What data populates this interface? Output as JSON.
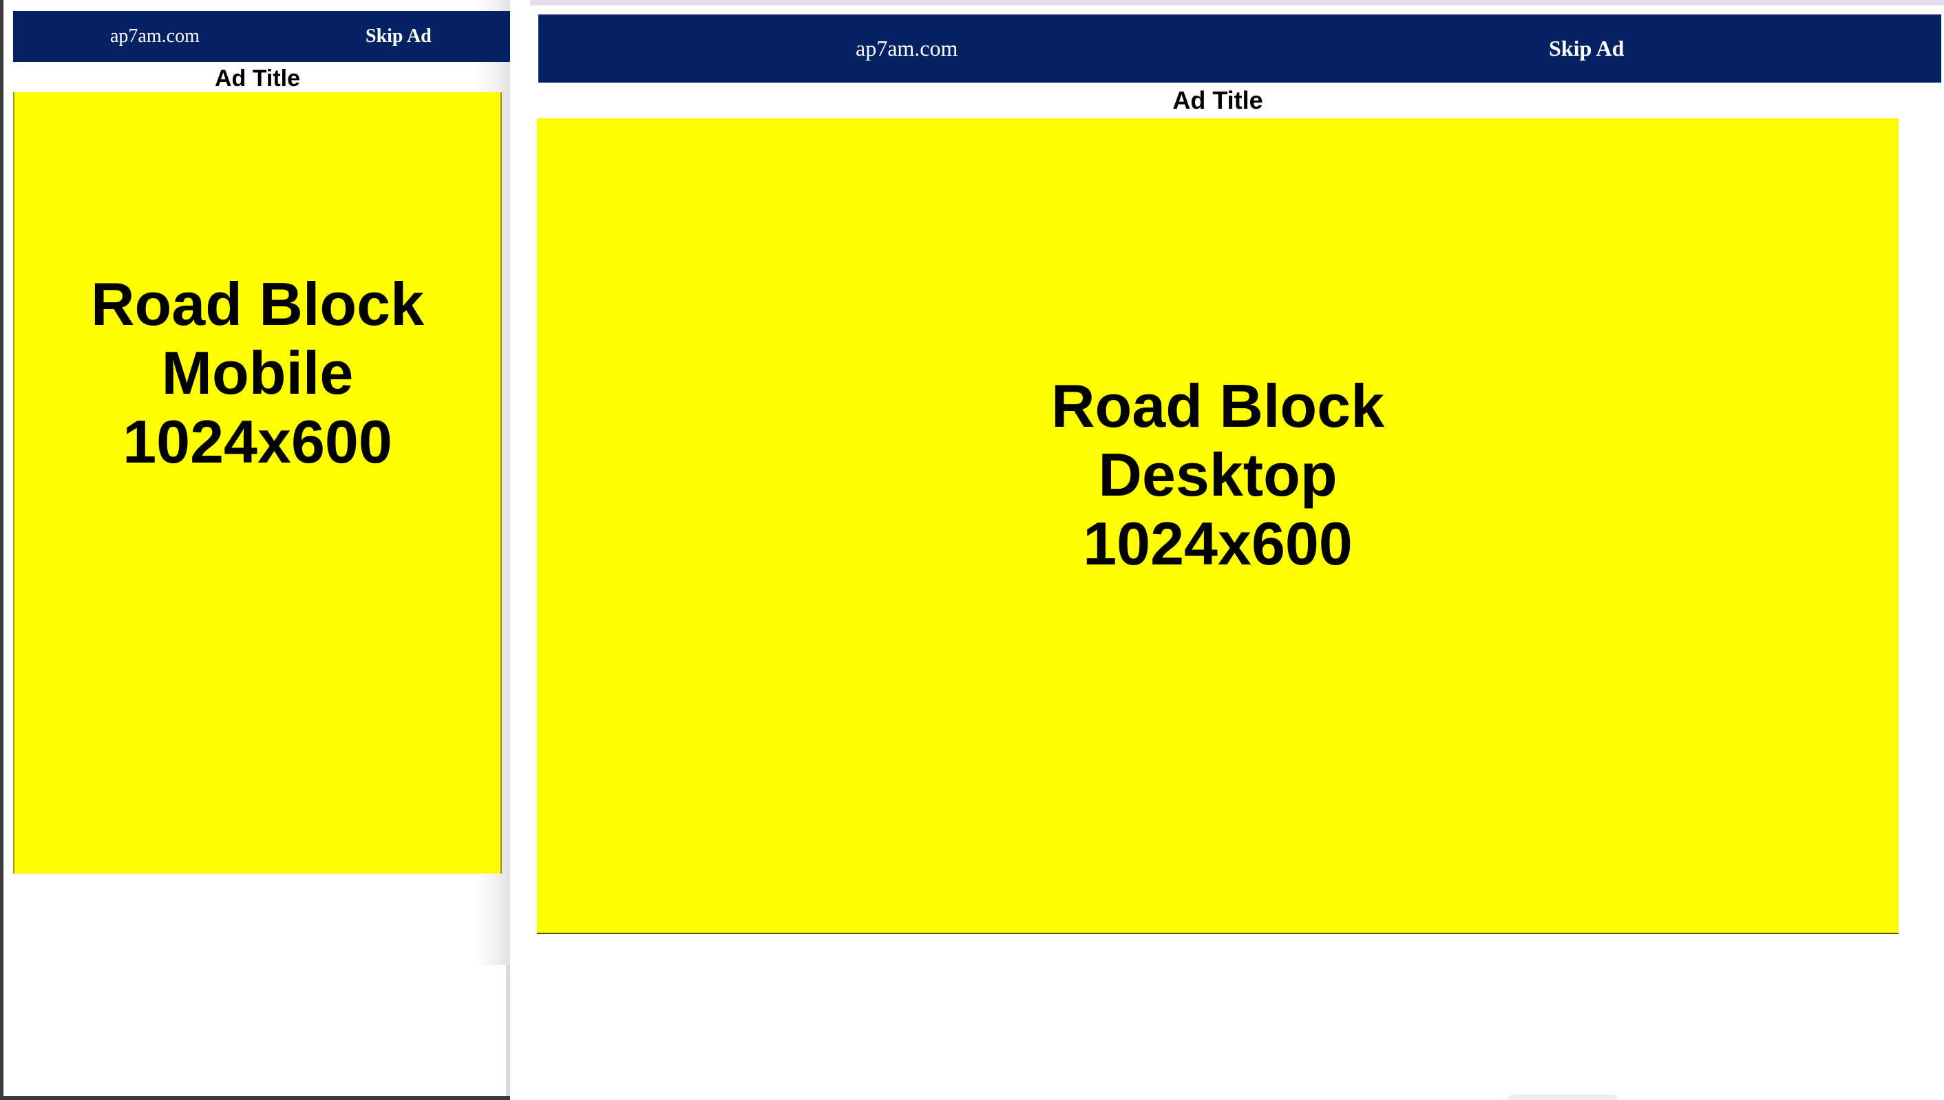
{
  "mobile": {
    "site_label": "ap7am.com",
    "skip_label": "Skip Ad",
    "ad_title": "Ad Title",
    "ad_text": "Road Block\nMobile\n1024x600"
  },
  "desktop": {
    "site_label": "ap7am.com",
    "skip_label": "Skip Ad",
    "ad_title": "Ad Title",
    "ad_text": "Road Block\nDesktop\n1024x600"
  },
  "colors": {
    "header_bg": "#042261",
    "ad_bg": "#ffff00",
    "header_text": "#ffffff"
  }
}
